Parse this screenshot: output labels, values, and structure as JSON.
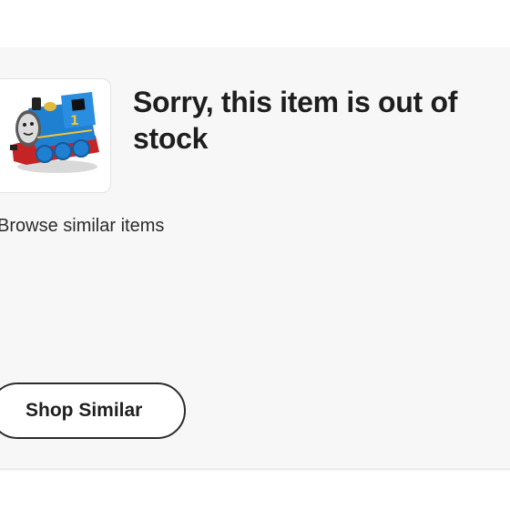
{
  "notice": {
    "title": "Sorry, this item is out of stock",
    "subtitle": "Browse similar items"
  },
  "product": {
    "image_name": "thomas-tank-engine-toy-image"
  },
  "actions": {
    "shop_similar_label": "Shop Similar"
  },
  "colors": {
    "card_background": "#f7f7f7",
    "text": "#1e1e1e",
    "button_border": "#2b2b2b",
    "engine_blue": "#1f7fd0",
    "engine_red": "#d42a2a"
  }
}
